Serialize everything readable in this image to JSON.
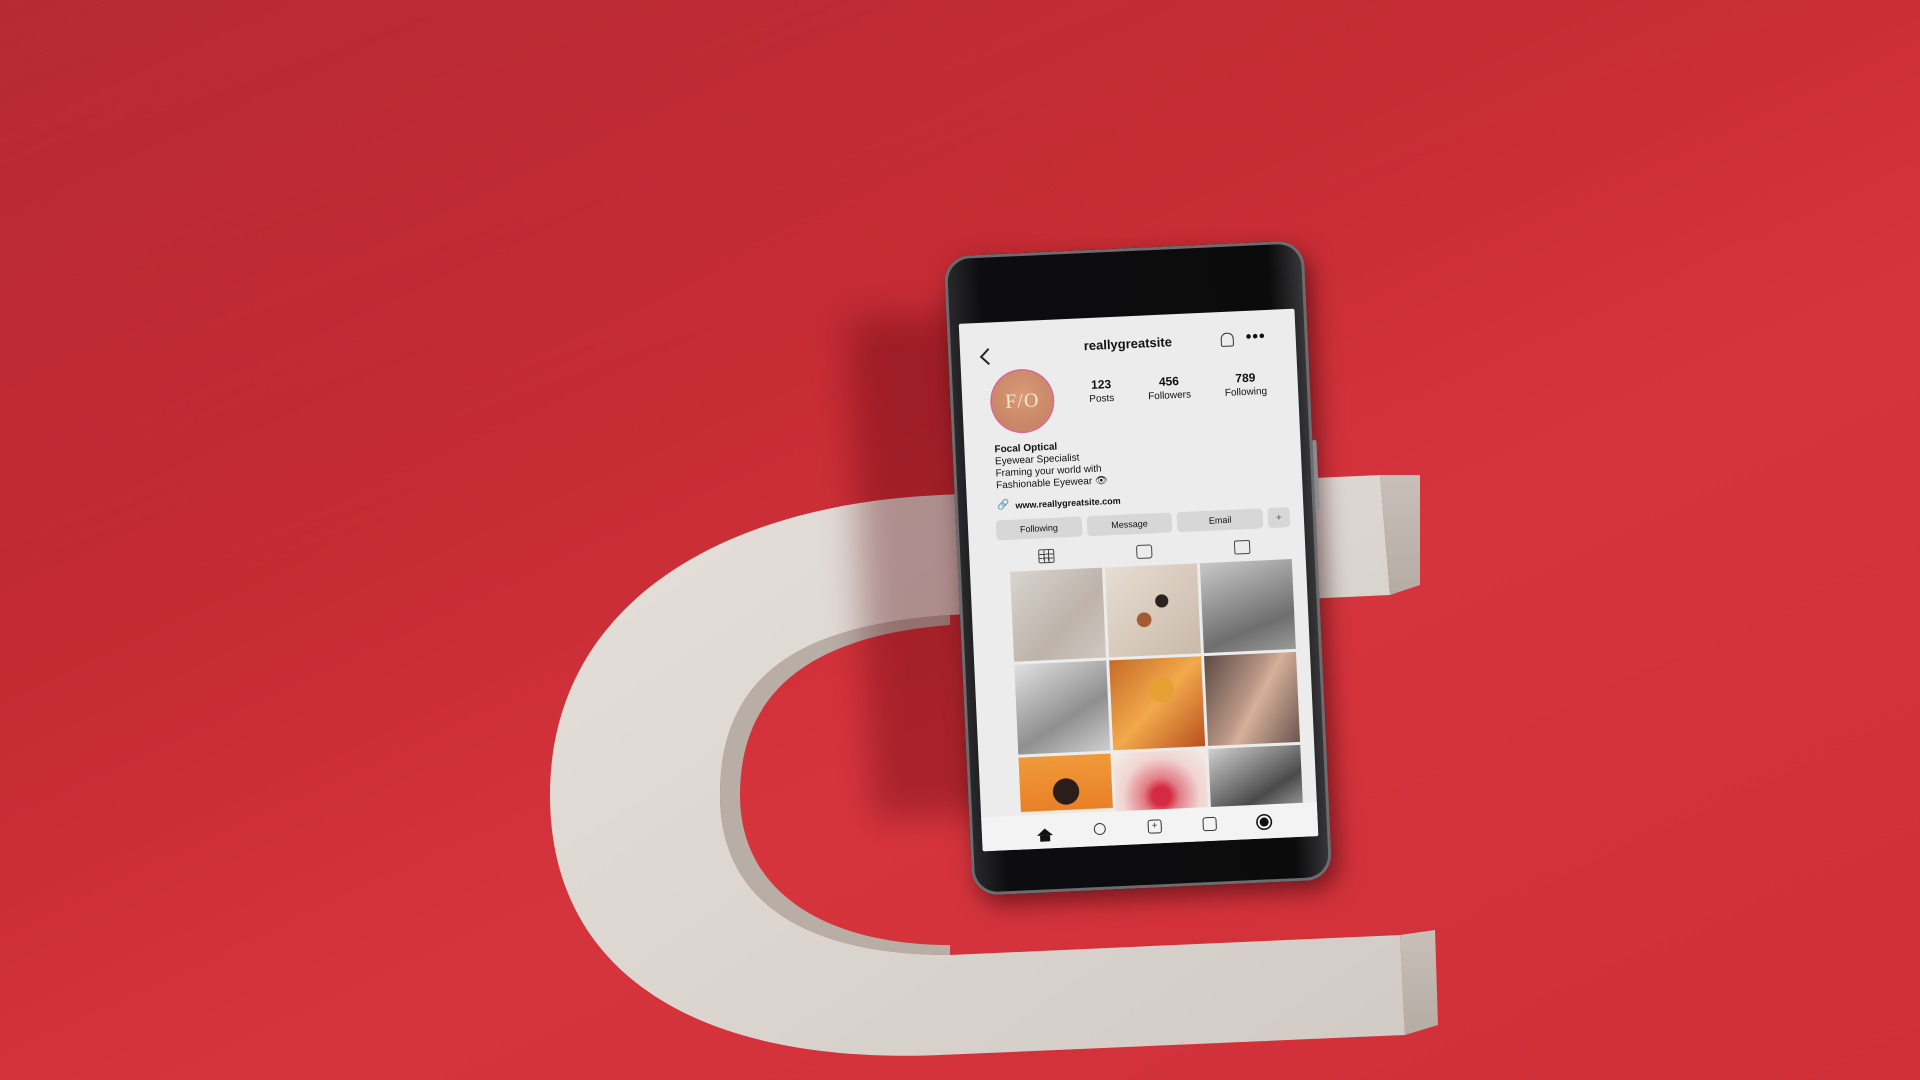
{
  "profile": {
    "username": "reallygreatsite",
    "avatar_initials": "F/O",
    "stats": [
      {
        "value": "123",
        "label": "Posts"
      },
      {
        "value": "456",
        "label": "Followers"
      },
      {
        "value": "789",
        "label": "Following"
      }
    ],
    "bio": {
      "name": "Focal Optical",
      "line1": "Eyewear Specialist",
      "line2": "Framing your world with",
      "line3": "Fashionable Eyewear 👁"
    },
    "link": "www.reallygreatsite.com",
    "buttons": {
      "following": "Following",
      "message": "Message",
      "email": "Email"
    }
  },
  "icons": {
    "back": "chevron-left-icon",
    "bell": "bell-icon",
    "more": "more-icon",
    "link": "link-icon",
    "add_person": "add-person-icon",
    "grid_tab": "grid-icon",
    "reels_tab": "reels-icon",
    "tagged_tab": "tagged-icon",
    "nav": [
      "home-icon",
      "search-icon",
      "add-icon",
      "reels-icon",
      "profile-icon"
    ]
  },
  "posts_count_shown": 9,
  "colors": {
    "background": "#c52a33",
    "prop": "#d8d2cd",
    "avatar": "#c98a66",
    "avatar_ring": "#d76a8a"
  }
}
